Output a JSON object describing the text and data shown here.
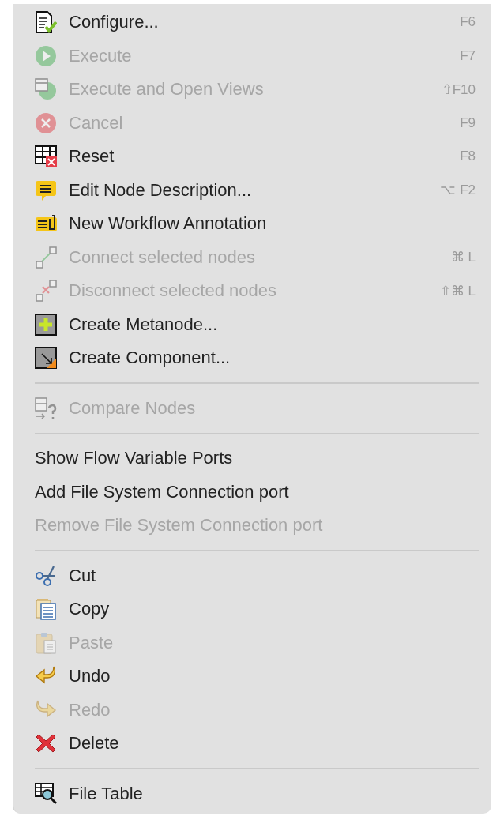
{
  "menu": {
    "sections": [
      {
        "items": [
          {
            "kind": "configure",
            "label": "Configure...",
            "shortcut": "F6",
            "disabled": false
          },
          {
            "kind": "execute",
            "label": "Execute",
            "shortcut": "F7",
            "disabled": true
          },
          {
            "kind": "execute-views",
            "label": "Execute and Open Views",
            "shortcut": "⇧F10",
            "disabled": true
          },
          {
            "kind": "cancel",
            "label": "Cancel",
            "shortcut": "F9",
            "disabled": true
          },
          {
            "kind": "reset",
            "label": "Reset",
            "shortcut": "F8",
            "disabled": false
          },
          {
            "kind": "description",
            "label": "Edit Node Description...",
            "shortcut": "⌥ F2",
            "disabled": false
          },
          {
            "kind": "annotation",
            "label": "New Workflow Annotation",
            "disabled": false
          },
          {
            "kind": "connect",
            "label": "Connect selected nodes",
            "shortcut": "⌘ L",
            "disabled": true
          },
          {
            "kind": "disconnect",
            "label": "Disconnect selected nodes",
            "shortcut": "⇧⌘ L",
            "disabled": true
          },
          {
            "kind": "metanode",
            "label": "Create Metanode...",
            "disabled": false
          },
          {
            "kind": "component",
            "label": "Create Component...",
            "disabled": false
          }
        ]
      },
      {
        "items": [
          {
            "kind": "compare",
            "label": "Compare Nodes",
            "disabled": true
          }
        ]
      },
      {
        "items": [
          {
            "label": "Show Flow Variable Ports",
            "disabled": false
          },
          {
            "label": "Add File System Connection port",
            "disabled": false
          },
          {
            "label": "Remove File System Connection port",
            "disabled": true
          }
        ]
      },
      {
        "items": [
          {
            "kind": "cut",
            "label": "Cut",
            "disabled": false
          },
          {
            "kind": "copy",
            "label": "Copy",
            "disabled": false
          },
          {
            "kind": "paste",
            "label": "Paste",
            "disabled": true
          },
          {
            "kind": "undo",
            "label": "Undo",
            "disabled": false
          },
          {
            "kind": "redo",
            "label": "Redo",
            "disabled": true
          },
          {
            "kind": "delete",
            "label": "Delete",
            "disabled": false
          }
        ]
      },
      {
        "items": [
          {
            "kind": "file-table",
            "label": "File Table",
            "disabled": false
          }
        ]
      }
    ]
  }
}
